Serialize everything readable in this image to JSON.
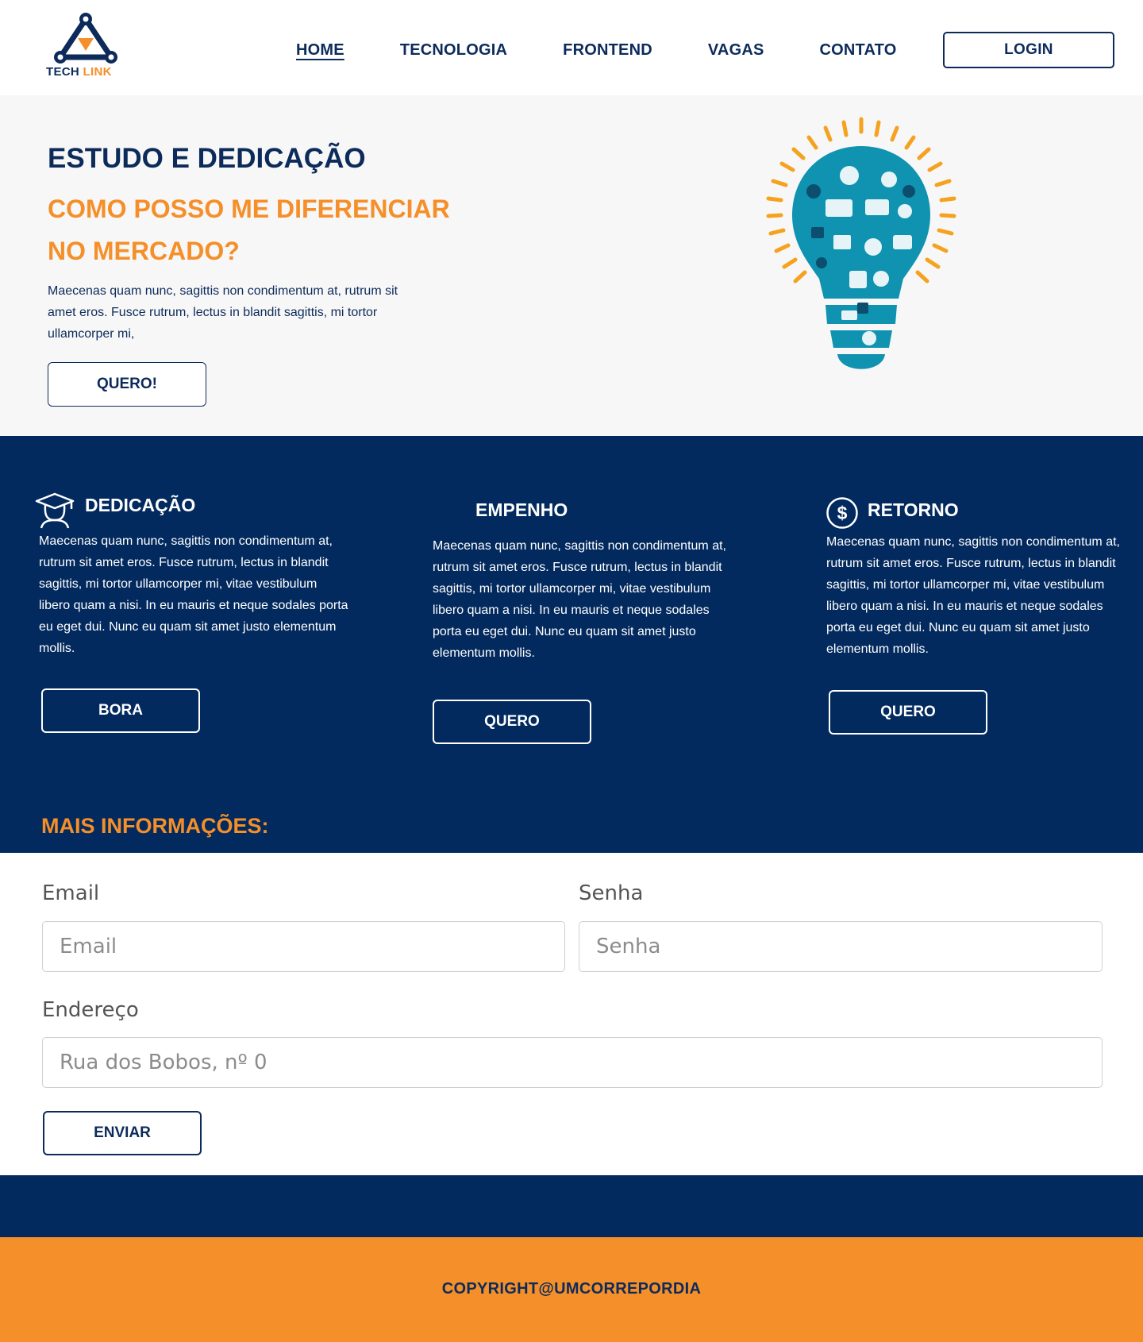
{
  "brand": {
    "logo_primary": "TECH",
    "logo_accent": "LINK",
    "primary_color": "#032a5e",
    "accent_color": "#f58f29"
  },
  "nav": {
    "items": [
      {
        "label": "HOME",
        "active": true
      },
      {
        "label": "TECNOLOGIA",
        "active": false
      },
      {
        "label": "FRONTEND",
        "active": false
      },
      {
        "label": "VAGAS",
        "active": false
      },
      {
        "label": "CONTATO",
        "active": false
      }
    ],
    "login_label": "LOGIN"
  },
  "hero": {
    "title": "ESTUDO E DEDICAÇÃO",
    "subtitle": "COMO POSSO ME DIFERENCIAR NO MERCADO?",
    "text": "Maecenas quam nunc, sagittis non condimentum at, rutrum sit amet eros. Fusce rutrum, lectus in blandit sagittis, mi tortor ullamcorper mi,",
    "button_label": "QUERO!",
    "image_icon": "lightbulb-icons-illustration"
  },
  "features": [
    {
      "title": "DEDICAÇÃO",
      "icon": "graduation-cap-icon",
      "text": "Maecenas quam nunc, sagittis non condimentum at, rutrum sit amet eros. Fusce rutrum, lectus in blandit sagittis, mi tortor ullamcorper mi, vitae vestibulum libero quam a nisi. In eu mauris et neque sodales porta eu eget dui. Nunc eu quam sit amet justo elementum mollis.",
      "button_label": "BORA"
    },
    {
      "title": "EMPENHO",
      "icon": "",
      "text": "Maecenas quam nunc, sagittis non condimentum at, rutrum sit amet eros. Fusce rutrum, lectus in blandit sagittis, mi tortor ullamcorper mi, vitae vestibulum libero quam a nisi. In eu mauris et neque sodales porta eu eget dui. Nunc eu quam sit amet justo elementum mollis.",
      "button_label": "QUERO"
    },
    {
      "title": "RETORNO",
      "icon": "dollar-circle-icon",
      "text": "Maecenas quam nunc, sagittis non condimentum at, rutrum sit amet eros. Fusce rutrum, lectus in blandit sagittis, mi tortor ullamcorper mi, vitae vestibulum libero quam a nisi. In eu mauris et neque sodales porta eu eget dui. Nunc eu quam sit amet justo elementum mollis.",
      "button_label": "QUERO"
    }
  ],
  "more_info": {
    "title": "MAIS INFORMAÇÕES:"
  },
  "form": {
    "email": {
      "label": "Email",
      "placeholder": "Email",
      "value": ""
    },
    "password": {
      "label": "Senha",
      "placeholder": "Senha",
      "value": ""
    },
    "address": {
      "label": "Endereço",
      "placeholder": "Rua dos Bobos, nº 0",
      "value": ""
    },
    "submit_label": "ENVIAR"
  },
  "footer": {
    "copyright": "COPYRIGHT@UMCORREPORDIA"
  }
}
